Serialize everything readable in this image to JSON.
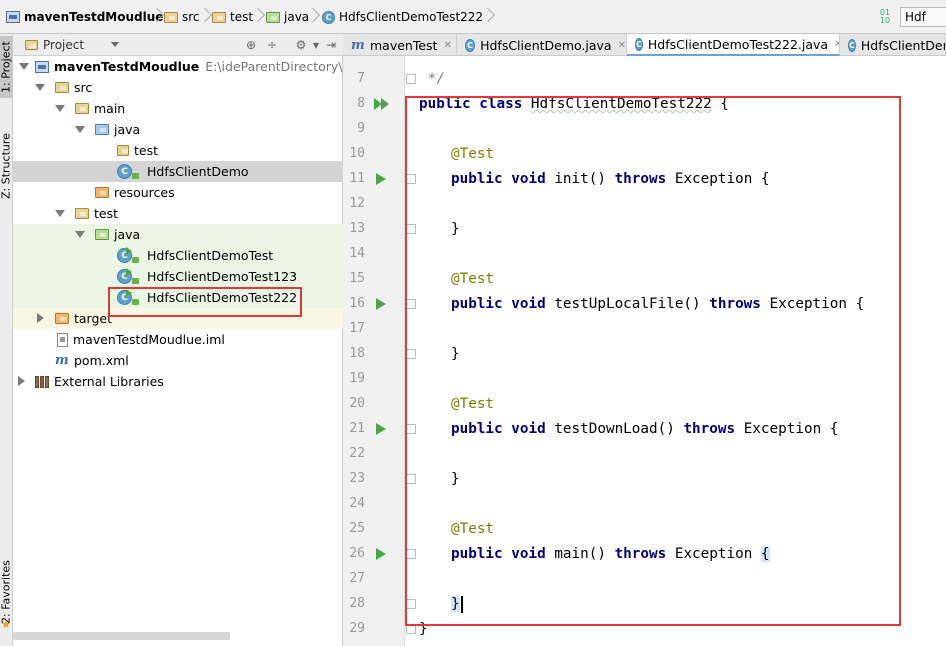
{
  "breadcrumb": {
    "project": "mavenTestdMoudlue",
    "src": "src",
    "test": "test",
    "java": "java",
    "file": "HdfsClientDemoTest222"
  },
  "topright": {
    "file_label": "Hdf"
  },
  "stripe": {
    "project_tab": "1: Project",
    "structure_tab": "Z: Structure",
    "favorites_tab": "2: Favorites"
  },
  "project_panel": {
    "title": "Project",
    "root_label": "mavenTestdMoudlue",
    "root_path": "E:\\ideParentDirectory\\mav",
    "items": [
      {
        "label": "src"
      },
      {
        "label": "main"
      },
      {
        "label": "java"
      },
      {
        "label": "test"
      },
      {
        "label": "HdfsClientDemo"
      },
      {
        "label": "resources"
      },
      {
        "label": "test"
      },
      {
        "label": "java"
      },
      {
        "label": "HdfsClientDemoTest"
      },
      {
        "label": "HdfsClientDemoTest123"
      },
      {
        "label": "HdfsClientDemoTest222"
      },
      {
        "label": "target"
      },
      {
        "label": "mavenTestdMoudlue.iml"
      },
      {
        "label": "pom.xml"
      },
      {
        "label": "External Libraries"
      }
    ]
  },
  "tabs": [
    {
      "label": "mavenTest",
      "icon": "m"
    },
    {
      "label": "HdfsClientDemo.java",
      "icon": "C"
    },
    {
      "label": "HdfsClientDemoTest222.java",
      "icon": "C"
    },
    {
      "label": "HdfsClientDem",
      "icon": "C"
    }
  ],
  "editor": {
    "lines": [
      {
        "num": "7"
      },
      {
        "num": "8"
      },
      {
        "num": "9"
      },
      {
        "num": "10"
      },
      {
        "num": "11"
      },
      {
        "num": "12"
      },
      {
        "num": "13"
      },
      {
        "num": "14"
      },
      {
        "num": "15"
      },
      {
        "num": "16"
      },
      {
        "num": "17"
      },
      {
        "num": "18"
      },
      {
        "num": "19"
      },
      {
        "num": "20"
      },
      {
        "num": "21"
      },
      {
        "num": "22"
      },
      {
        "num": "23"
      },
      {
        "num": "24"
      },
      {
        "num": "25"
      },
      {
        "num": "26"
      },
      {
        "num": "27"
      },
      {
        "num": "28"
      },
      {
        "num": "29"
      }
    ],
    "code": {
      "l7": " */",
      "public_kw": "public",
      "class_kw": "class",
      "class_name": "HdfsClientDemoTest222",
      "open_brace": " {",
      "test_ann": "@Test",
      "void_kw": "void",
      "throws_kw": "throws",
      "exception": "Exception",
      "m_init": "init()",
      "m_upload": "testUpLocalFile()",
      "m_download": "testDownLoad()",
      "m_main": "main()",
      "close_brace": "}"
    }
  }
}
